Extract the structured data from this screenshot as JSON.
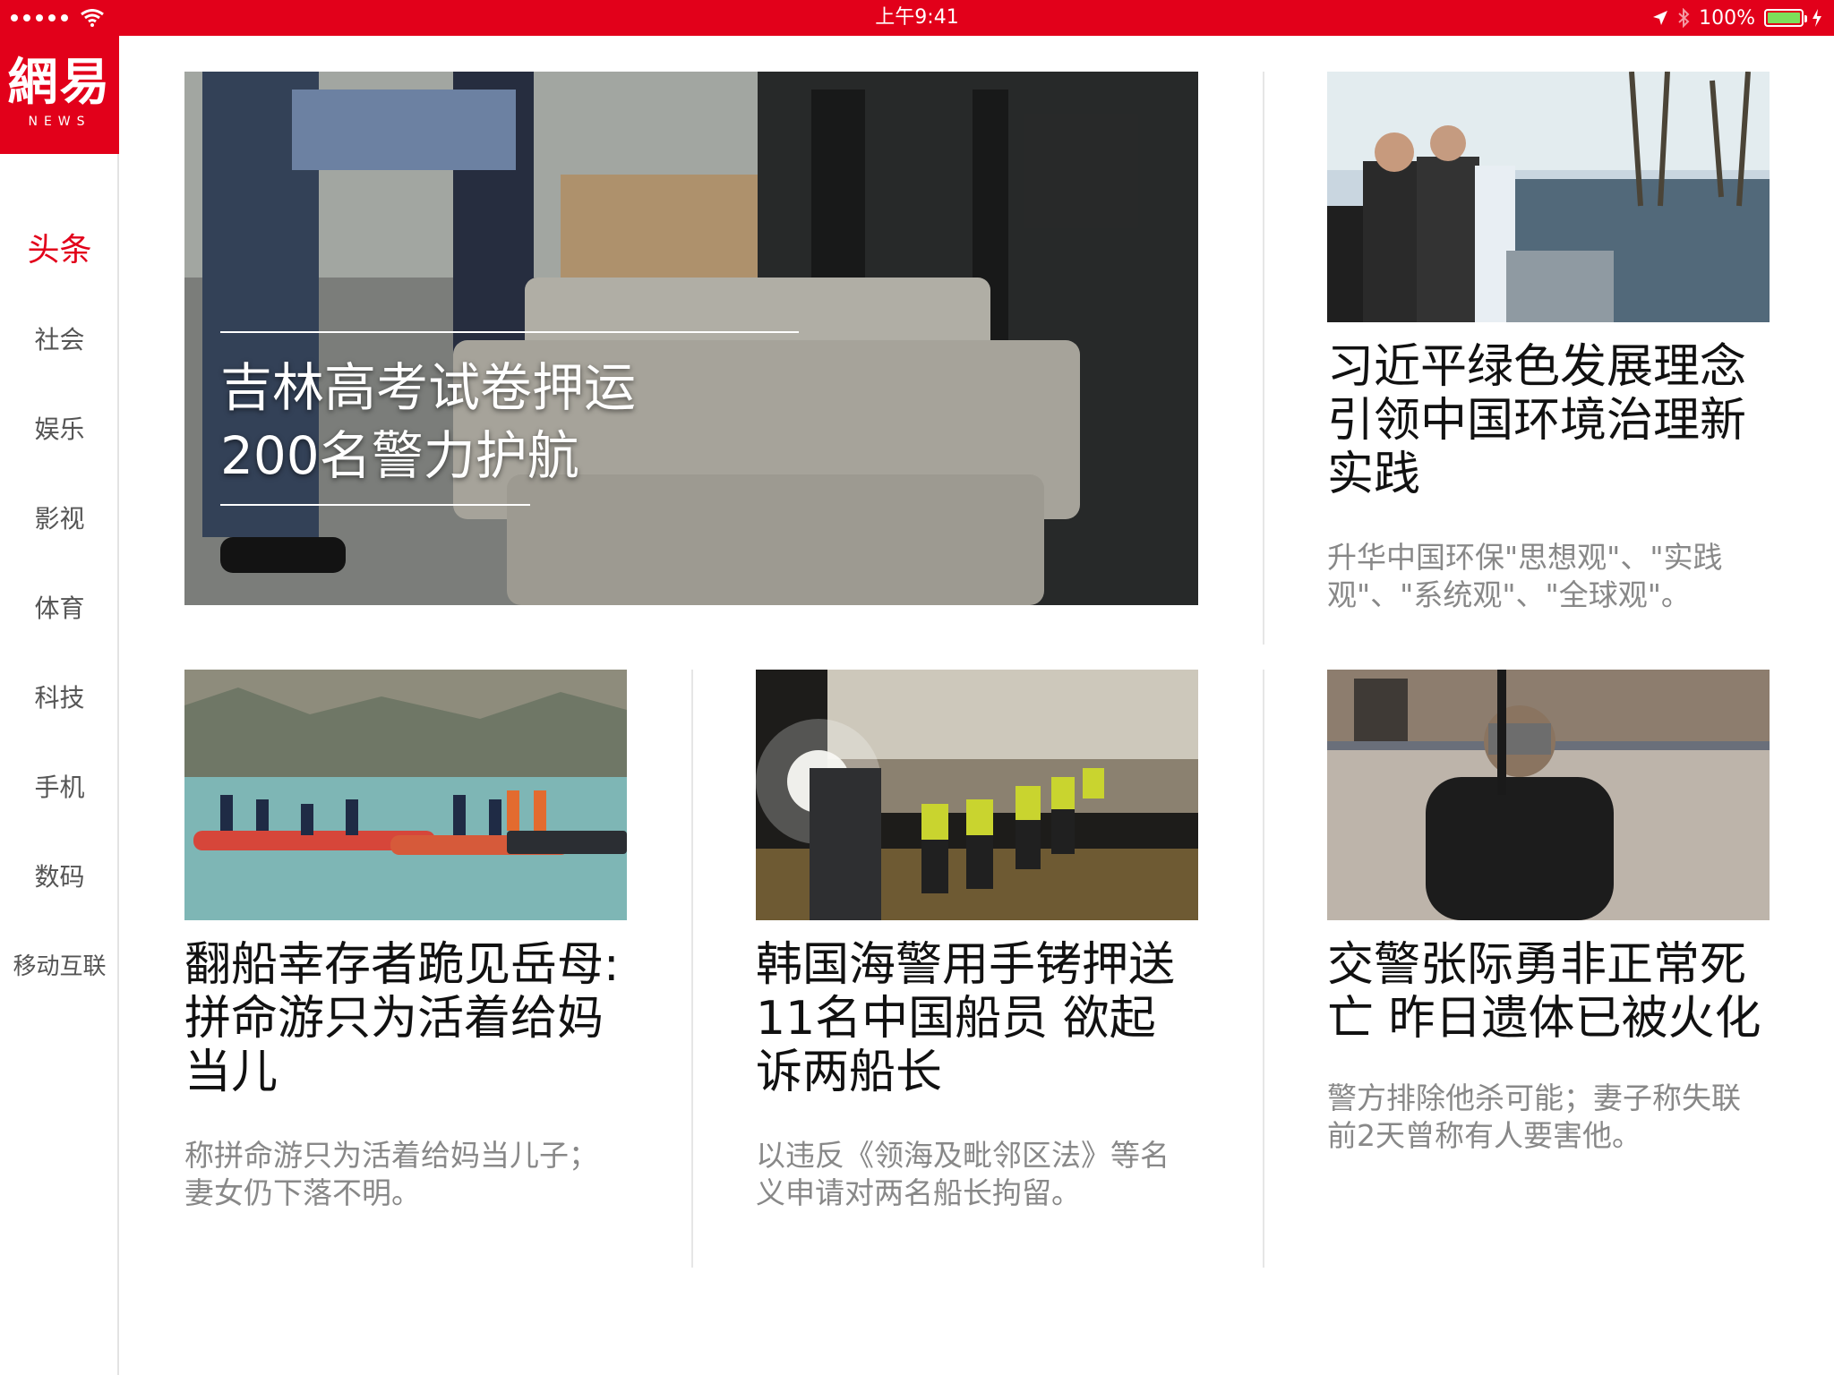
{
  "status_bar": {
    "time": "上午9:41",
    "battery": "100%",
    "battery_level": 1.0,
    "icons": [
      "signal-dots",
      "wifi-icon",
      "location-icon",
      "bluetooth-icon",
      "battery-icon",
      "charging-icon"
    ]
  },
  "logo": {
    "main": "網易",
    "sub": "NEWS"
  },
  "sidebar": {
    "items": [
      {
        "label": "头条"
      },
      {
        "label": "社会"
      },
      {
        "label": "娱乐"
      },
      {
        "label": "影视"
      },
      {
        "label": "体育"
      },
      {
        "label": "科技"
      },
      {
        "label": "手机"
      },
      {
        "label": "数码"
      },
      {
        "label": "移动互联"
      }
    ]
  },
  "colors": {
    "accent": "#e2001a",
    "summary_text": "#888888"
  },
  "articles": {
    "hero": {
      "title_line1": "吉林高考试卷押运",
      "title_line2": "200名警力护航"
    },
    "top_right": {
      "headline": "习近平绿色发展理念引领中国环境治理新实践",
      "summary": "升华中国环保\"思想观\"、\"实践观\"、\"系统观\"、\"全球观\"。"
    },
    "bottom_left": {
      "headline": "翻船幸存者跪见岳母:拼命游只为活着给妈当儿",
      "summary": "称拼命游只为活着给妈当儿子；妻女仍下落不明。"
    },
    "bottom_middle": {
      "headline": "韩国海警用手铐押送11名中国船员 欲起诉两船长",
      "summary": "以违反《领海及毗邻区法》等名义申请对两名船长拘留。"
    },
    "bottom_right": {
      "headline": "交警张际勇非正常死亡 昨日遗体已被火化",
      "summary": "警方排除他杀可能；妻子称失联前2天曾称有人要害他。"
    }
  }
}
